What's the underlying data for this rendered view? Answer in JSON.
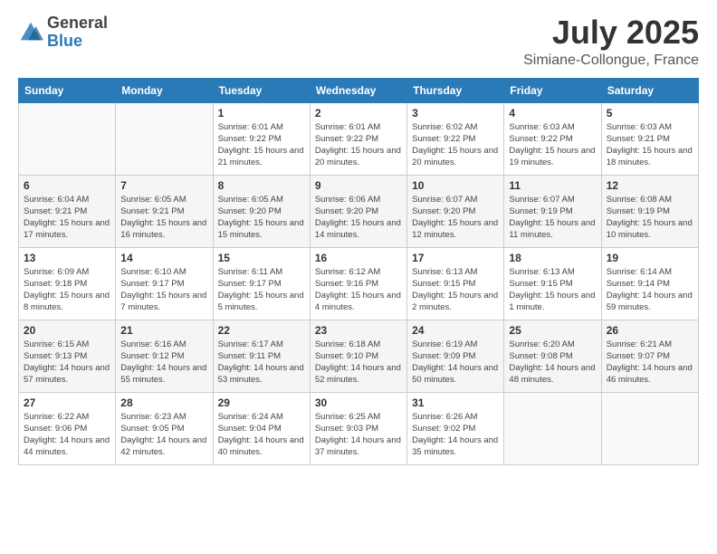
{
  "logo": {
    "general": "General",
    "blue": "Blue"
  },
  "title": "July 2025",
  "subtitle": "Simiane-Collongue, France",
  "days_of_week": [
    "Sunday",
    "Monday",
    "Tuesday",
    "Wednesday",
    "Thursday",
    "Friday",
    "Saturday"
  ],
  "weeks": [
    [
      {
        "day": "",
        "info": ""
      },
      {
        "day": "",
        "info": ""
      },
      {
        "day": "1",
        "info": "Sunrise: 6:01 AM\nSunset: 9:22 PM\nDaylight: 15 hours and 21 minutes."
      },
      {
        "day": "2",
        "info": "Sunrise: 6:01 AM\nSunset: 9:22 PM\nDaylight: 15 hours and 20 minutes."
      },
      {
        "day": "3",
        "info": "Sunrise: 6:02 AM\nSunset: 9:22 PM\nDaylight: 15 hours and 20 minutes."
      },
      {
        "day": "4",
        "info": "Sunrise: 6:03 AM\nSunset: 9:22 PM\nDaylight: 15 hours and 19 minutes."
      },
      {
        "day": "5",
        "info": "Sunrise: 6:03 AM\nSunset: 9:21 PM\nDaylight: 15 hours and 18 minutes."
      }
    ],
    [
      {
        "day": "6",
        "info": "Sunrise: 6:04 AM\nSunset: 9:21 PM\nDaylight: 15 hours and 17 minutes."
      },
      {
        "day": "7",
        "info": "Sunrise: 6:05 AM\nSunset: 9:21 PM\nDaylight: 15 hours and 16 minutes."
      },
      {
        "day": "8",
        "info": "Sunrise: 6:05 AM\nSunset: 9:20 PM\nDaylight: 15 hours and 15 minutes."
      },
      {
        "day": "9",
        "info": "Sunrise: 6:06 AM\nSunset: 9:20 PM\nDaylight: 15 hours and 14 minutes."
      },
      {
        "day": "10",
        "info": "Sunrise: 6:07 AM\nSunset: 9:20 PM\nDaylight: 15 hours and 12 minutes."
      },
      {
        "day": "11",
        "info": "Sunrise: 6:07 AM\nSunset: 9:19 PM\nDaylight: 15 hours and 11 minutes."
      },
      {
        "day": "12",
        "info": "Sunrise: 6:08 AM\nSunset: 9:19 PM\nDaylight: 15 hours and 10 minutes."
      }
    ],
    [
      {
        "day": "13",
        "info": "Sunrise: 6:09 AM\nSunset: 9:18 PM\nDaylight: 15 hours and 8 minutes."
      },
      {
        "day": "14",
        "info": "Sunrise: 6:10 AM\nSunset: 9:17 PM\nDaylight: 15 hours and 7 minutes."
      },
      {
        "day": "15",
        "info": "Sunrise: 6:11 AM\nSunset: 9:17 PM\nDaylight: 15 hours and 5 minutes."
      },
      {
        "day": "16",
        "info": "Sunrise: 6:12 AM\nSunset: 9:16 PM\nDaylight: 15 hours and 4 minutes."
      },
      {
        "day": "17",
        "info": "Sunrise: 6:13 AM\nSunset: 9:15 PM\nDaylight: 15 hours and 2 minutes."
      },
      {
        "day": "18",
        "info": "Sunrise: 6:13 AM\nSunset: 9:15 PM\nDaylight: 15 hours and 1 minute."
      },
      {
        "day": "19",
        "info": "Sunrise: 6:14 AM\nSunset: 9:14 PM\nDaylight: 14 hours and 59 minutes."
      }
    ],
    [
      {
        "day": "20",
        "info": "Sunrise: 6:15 AM\nSunset: 9:13 PM\nDaylight: 14 hours and 57 minutes."
      },
      {
        "day": "21",
        "info": "Sunrise: 6:16 AM\nSunset: 9:12 PM\nDaylight: 14 hours and 55 minutes."
      },
      {
        "day": "22",
        "info": "Sunrise: 6:17 AM\nSunset: 9:11 PM\nDaylight: 14 hours and 53 minutes."
      },
      {
        "day": "23",
        "info": "Sunrise: 6:18 AM\nSunset: 9:10 PM\nDaylight: 14 hours and 52 minutes."
      },
      {
        "day": "24",
        "info": "Sunrise: 6:19 AM\nSunset: 9:09 PM\nDaylight: 14 hours and 50 minutes."
      },
      {
        "day": "25",
        "info": "Sunrise: 6:20 AM\nSunset: 9:08 PM\nDaylight: 14 hours and 48 minutes."
      },
      {
        "day": "26",
        "info": "Sunrise: 6:21 AM\nSunset: 9:07 PM\nDaylight: 14 hours and 46 minutes."
      }
    ],
    [
      {
        "day": "27",
        "info": "Sunrise: 6:22 AM\nSunset: 9:06 PM\nDaylight: 14 hours and 44 minutes."
      },
      {
        "day": "28",
        "info": "Sunrise: 6:23 AM\nSunset: 9:05 PM\nDaylight: 14 hours and 42 minutes."
      },
      {
        "day": "29",
        "info": "Sunrise: 6:24 AM\nSunset: 9:04 PM\nDaylight: 14 hours and 40 minutes."
      },
      {
        "day": "30",
        "info": "Sunrise: 6:25 AM\nSunset: 9:03 PM\nDaylight: 14 hours and 37 minutes."
      },
      {
        "day": "31",
        "info": "Sunrise: 6:26 AM\nSunset: 9:02 PM\nDaylight: 14 hours and 35 minutes."
      },
      {
        "day": "",
        "info": ""
      },
      {
        "day": "",
        "info": ""
      }
    ]
  ]
}
